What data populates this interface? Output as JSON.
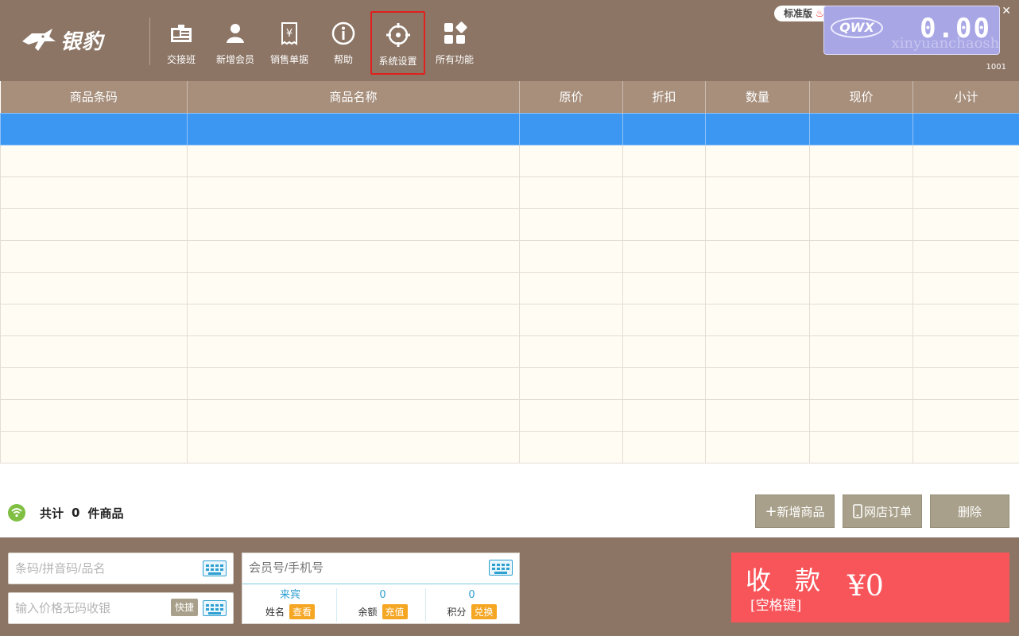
{
  "brand": {
    "logo_text": "银豹"
  },
  "toolbar": {
    "items": [
      {
        "label": "交接班"
      },
      {
        "label": "新增会员"
      },
      {
        "label": "销售单据"
      },
      {
        "label": "帮助"
      },
      {
        "label": "系统设置"
      },
      {
        "label": "所有功能"
      }
    ]
  },
  "header": {
    "edition": "标准版",
    "window_controls": [
      "—",
      "▢",
      "✕"
    ],
    "display": {
      "logo": "QWX",
      "amount": "0.00",
      "store_name": "xinyuanchaoshi"
    },
    "store_no": "1001"
  },
  "table": {
    "columns": [
      "商品条码",
      "商品名称",
      "原价",
      "折扣",
      "数量",
      "现价",
      "小计"
    ],
    "row_count": 11,
    "selected_row": 0
  },
  "summary": {
    "prefix": "共计",
    "count": "0",
    "suffix": "件商品"
  },
  "actions": {
    "add_product": "新增商品",
    "online_orders": "网店订单",
    "delete": "删除"
  },
  "inputs": {
    "barcode_placeholder": "条码/拼音码/品名",
    "price_placeholder": "输入价格无码收银",
    "quick_label": "快捷",
    "member_placeholder": "会员号/手机号"
  },
  "member": {
    "name_value": "来宾",
    "name_label": "姓名",
    "name_action": "查看",
    "balance_value": "0",
    "balance_label": "余额",
    "balance_action": "充值",
    "points_value": "0",
    "points_label": "积分",
    "points_action": "兑换"
  },
  "checkout": {
    "label": "收 款",
    "hint": "[空格键]",
    "total": "¥0"
  },
  "colors": {
    "topbar": "#8c7565",
    "header_row": "#a78f7c",
    "selected_row": "#3c97f3",
    "pay_button": "#f8555b",
    "accent": "#2e9fd1",
    "badge": "#f5a623"
  }
}
